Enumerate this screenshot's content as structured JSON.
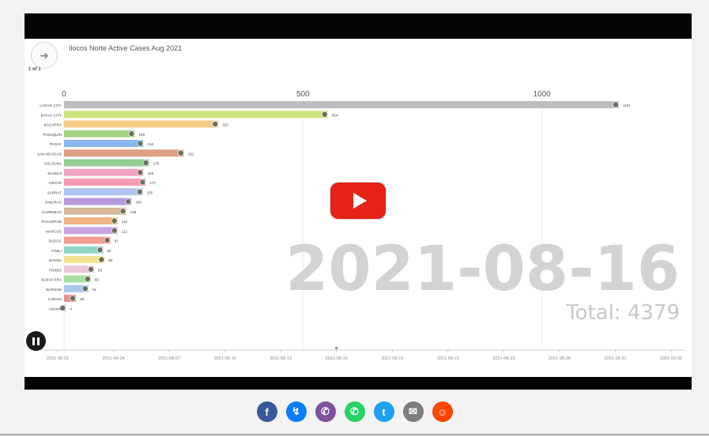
{
  "video": {
    "title": "Ilocos Norte Active Cases Aug 2021",
    "page_count": "1 of 1",
    "nav_icon": "arrow-right-icon",
    "date_display": "2021-08-16",
    "total_display": "Total: 4379",
    "play_icon": "youtube-play-icon",
    "pause_icon": "pause-icon",
    "colors": {
      "play_button": "#e62117",
      "letterbox": "#050505"
    }
  },
  "chart_data": {
    "type": "bar",
    "orientation": "horizontal",
    "xlim": [
      0,
      1300
    ],
    "x_ticks": [
      "0",
      "500",
      "1000"
    ],
    "grid": true,
    "categories": [
      "LAOAG CITY",
      "BATAC CITY",
      "BACARRA",
      "PASUQUIN",
      "PAOAY",
      "SAN NICOLAS",
      "SOLSONA",
      "BANGUI",
      "VINTAR",
      "SARRAT",
      "DINGRAS",
      "CURRIMAO",
      "PAGUDPUD",
      "MARCOS",
      "BADOC",
      "PINILI",
      "BANNA",
      "PIDDIG",
      "NUEVA ERA",
      "BURGOS",
      "CARASI",
      "ADAMS"
    ],
    "values": [
      1161,
      552,
      323,
      148,
      166,
      251,
      178,
      166,
      171,
      165,
      141,
      130,
      112,
      112,
      97,
      82,
      85,
      63,
      56,
      51,
      25,
      4
    ],
    "value_labels": [
      "1161",
      "564",
      "323",
      "168",
      "216",
      "191",
      "178",
      "168",
      "171",
      "155",
      "150",
      "138",
      "112",
      "112",
      "97",
      "82",
      "85",
      "63",
      "56",
      "51",
      "25",
      "4"
    ],
    "colors": [
      "#bdbdbd",
      "#cce57a",
      "#f7cc86",
      "#a6d184",
      "#87b8ee",
      "#dea084",
      "#95cc91",
      "#f0a3c0",
      "#f59ab4",
      "#b0c4f0",
      "#b799dd",
      "#d4b898",
      "#efb584",
      "#c7a5e6",
      "#ef9c8a",
      "#8fd6c4",
      "#f1e493",
      "#edc4da",
      "#a4e0a0",
      "#a7c7f0",
      "#e79292",
      "#c9d6e4"
    ],
    "time_axis_labels": [
      "2021-08-01",
      "2021-08-04",
      "2021-08-07",
      "2021-08-10",
      "2021-08-13",
      "2021-08-16",
      "2021-08-19",
      "2021-08-22",
      "2021-08-25",
      "2021-08-28",
      "2021-08-31",
      "2021-09-02"
    ],
    "current_date": "2021-08-16",
    "total": 4379
  },
  "share": {
    "buttons": [
      {
        "name": "facebook",
        "glyph": "f",
        "color": "#3b5998",
        "icon": "facebook-icon"
      },
      {
        "name": "messenger",
        "glyph": "↯",
        "color": "#0a7cff",
        "icon": "messenger-icon"
      },
      {
        "name": "viber",
        "glyph": "✆",
        "color": "#7c529e",
        "icon": "viber-icon"
      },
      {
        "name": "whatsapp",
        "glyph": "✆",
        "color": "#25d366",
        "icon": "whatsapp-icon"
      },
      {
        "name": "twitter",
        "glyph": "t",
        "color": "#1da1f2",
        "icon": "twitter-icon"
      },
      {
        "name": "email",
        "glyph": "✉",
        "color": "#7d7d7d",
        "icon": "email-icon"
      },
      {
        "name": "reddit",
        "glyph": "☺",
        "color": "#ff4500",
        "icon": "reddit-icon"
      }
    ]
  }
}
